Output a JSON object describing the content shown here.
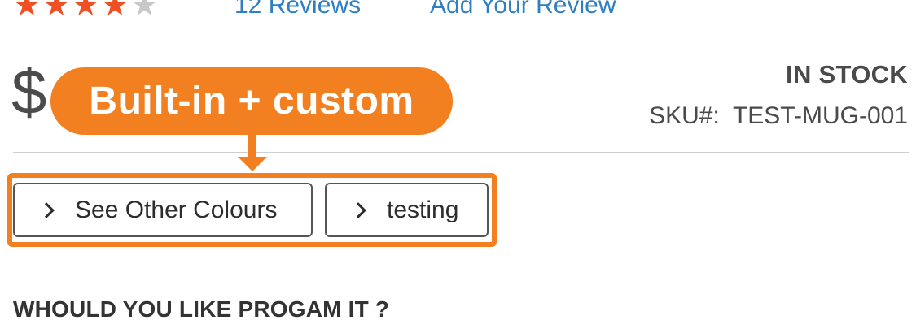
{
  "rating": {
    "stars": [
      {
        "icon": "star-filled-icon",
        "glyph": "★",
        "color": "#f04e23"
      },
      {
        "icon": "star-filled-icon",
        "glyph": "★",
        "color": "#f04e23"
      },
      {
        "icon": "star-filled-icon",
        "glyph": "★",
        "color": "#f04e23"
      },
      {
        "icon": "star-filled-icon",
        "glyph": "★",
        "color": "#f04e23"
      },
      {
        "icon": "star-empty-icon",
        "glyph": "★",
        "color": "#c8c8c8"
      }
    ],
    "value": 4,
    "max": 5,
    "reviews_link": "12  Reviews",
    "add_review_link": "Add Your Review"
  },
  "product": {
    "price": "$",
    "stock_status": "IN STOCK",
    "sku": "SKU#:  TEST-MUG-001"
  },
  "annotation": {
    "callout_text": "Built-in + custom",
    "accent_color": "#f28021"
  },
  "tabs": [
    {
      "icon": "chevron-right-icon",
      "label": "See Other Colours"
    },
    {
      "icon": "chevron-right-icon",
      "label": "testing"
    }
  ],
  "section": {
    "heading": "WHOULD YOU LIKE PROGAM IT ?"
  },
  "colors": {
    "link": "#2f7fc1",
    "text": "#4a4a4a",
    "star_filled": "#f04e23",
    "star_empty": "#c8c8c8"
  }
}
